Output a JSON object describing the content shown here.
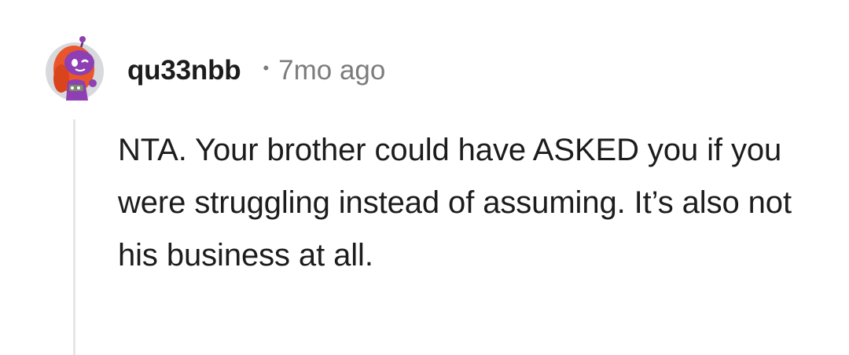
{
  "comment": {
    "username": "qu33nbb",
    "separator": "•",
    "timestamp": "7mo ago",
    "text": "NTA. Your brother could have ASKED you if you were struggling instead of assuming. It’s also not his business at all.",
    "avatar_icon": "snoo-avatar-icon"
  },
  "colors": {
    "username": "#1c1c1c",
    "timestamp": "#7c7c7c",
    "thread_line": "#e6e6e6",
    "avatar_body": "#8e3fb3",
    "avatar_hair": "#e8562a"
  }
}
